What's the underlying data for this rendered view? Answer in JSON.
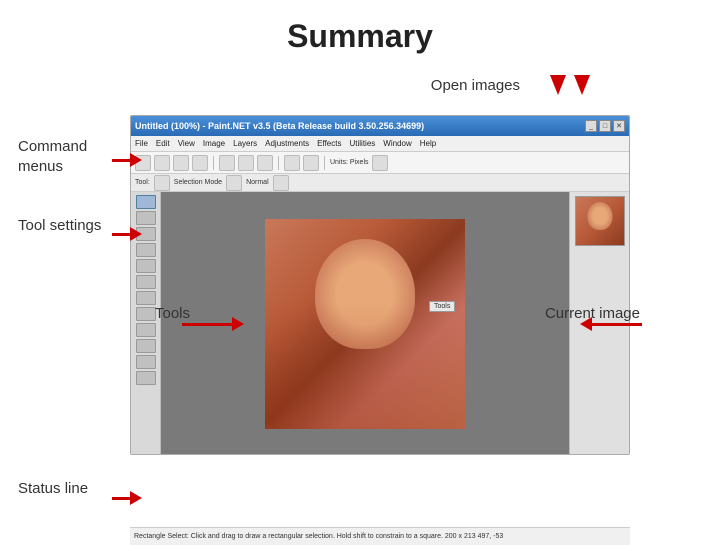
{
  "title": "Summary",
  "labels": {
    "open_images": "Open images",
    "command_menus": "Command\nmenus",
    "tool_settings": "Tool settings",
    "tools": "Tools",
    "current_image": "Current image",
    "status_line": "Status line"
  },
  "screenshot": {
    "titlebar_text": "Untitled (100%) - Paint.NET v3.5 (Beta Release build 3.50.256.34699)",
    "menubar_items": [
      "File",
      "Edit",
      "View",
      "Image",
      "Layers",
      "Adjustments",
      "Effects",
      "Utilities",
      "Window",
      "Help"
    ],
    "toolbar_label": "Units: Pixels",
    "tooloptions_label": "Tool:  Selection Mode     Normal",
    "statusbar_text": "Rectangle Select: Click and drag to draw a rectangular selection. Hold shift to constrain to a square.    200 x 213    497, -53",
    "tools_label": "Tools"
  },
  "colors": {
    "arrow": "#cc0000",
    "title": "#222222",
    "label": "#333333"
  }
}
